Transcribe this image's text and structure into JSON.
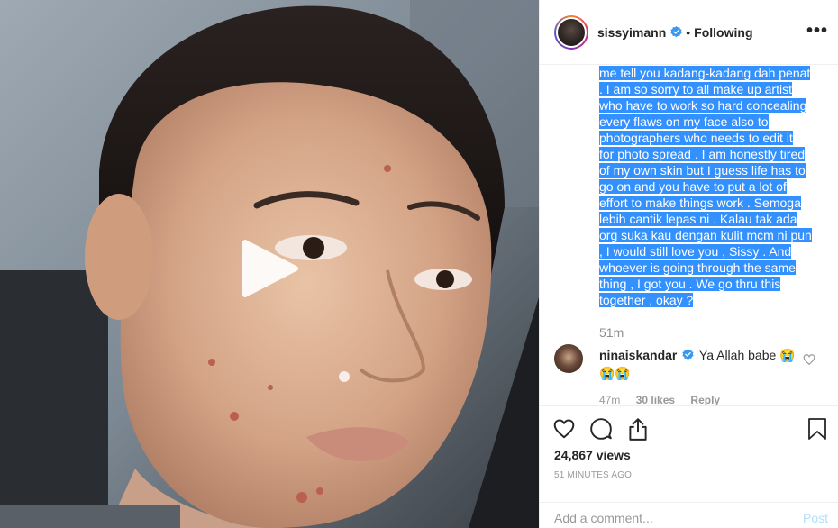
{
  "post": {
    "username": "sissyimann",
    "follow_status": "Following",
    "dot": "•",
    "more_label": "•••"
  },
  "caption": {
    "lines": [
      "me tell you kadang-kadang dah penat",
      ". I am so sorry to all make up artist",
      "who have to work so hard concealing",
      "every flaws on my face also to",
      "photographers who needs to edit it",
      "for photo spread . I am honestly tired",
      "of my own skin but I guess life has to",
      "go on and you have to put a lot of",
      "effort to make things work . Semoga",
      "lebih cantik lepas ni . Kalau tak ada",
      "org suka kau dengan kulit mcm ni pun",
      ", I would still love you , Sissy . And",
      "whoever is going through the same",
      "thing , I got you . We go thru this",
      "together , okay ?"
    ],
    "time": "51m"
  },
  "comment": {
    "username": "ninaiskandar",
    "text": "Ya Allah babe 😭",
    "text2": "😭😭",
    "time": "47m",
    "likes": "30 likes",
    "reply": "Reply"
  },
  "stats": {
    "views": "24,867 views",
    "posted": "51 MINUTES AGO"
  },
  "composer": {
    "placeholder": "Add a comment...",
    "post_label": "Post"
  },
  "colors": {
    "selection": "#3390ff",
    "verified": "#3897f0",
    "post_disabled": "#b2dffc"
  },
  "icons": {
    "play": "play-icon",
    "like": "heart-icon",
    "comment": "comment-bubble-icon",
    "share": "share-icon",
    "save": "bookmark-icon",
    "verified": "verified-badge-icon"
  }
}
